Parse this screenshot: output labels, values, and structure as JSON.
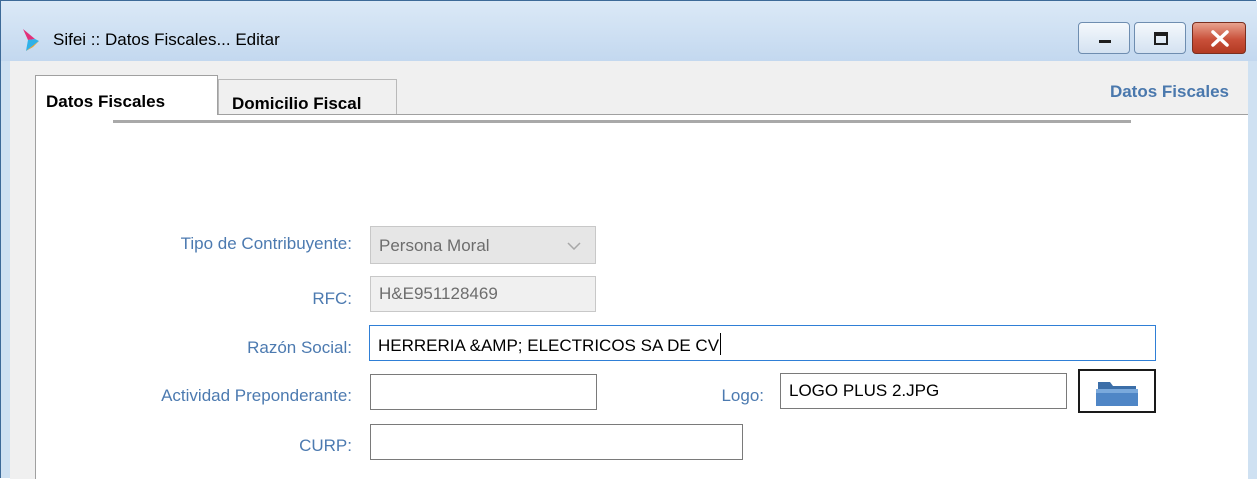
{
  "window": {
    "title": "Sifei :: Datos Fiscales... Editar",
    "icons": [
      "app-logo-icon",
      "minimize-icon",
      "maximize-icon",
      "close-icon"
    ]
  },
  "tabs": [
    {
      "label": "Datos Fiscales",
      "active": true
    },
    {
      "label": "Domicilio Fiscal",
      "active": false
    }
  ],
  "section": {
    "title": "Datos Fiscales"
  },
  "form": {
    "tipo_contribuyente": {
      "label": "Tipo de Contribuyente:",
      "value": "Persona Moral"
    },
    "rfc": {
      "label": "RFC:",
      "value": "H&E951128469"
    },
    "razon_social": {
      "label": "Razón Social:",
      "value": "HERRERIA &AMP; ELECTRICOS SA DE CV"
    },
    "actividad": {
      "label": "Actividad Preponderante:",
      "value": ""
    },
    "logo": {
      "label": "Logo:",
      "value": "LOGO PLUS 2.JPG",
      "button_icon": "folder-icon"
    },
    "curp": {
      "label": "CURP:",
      "value": ""
    }
  },
  "colors": {
    "label": "#4c7ab0",
    "section_title": "#4a78ad",
    "close_button": "#c9503a",
    "focus_border": "#2f7fd6"
  }
}
